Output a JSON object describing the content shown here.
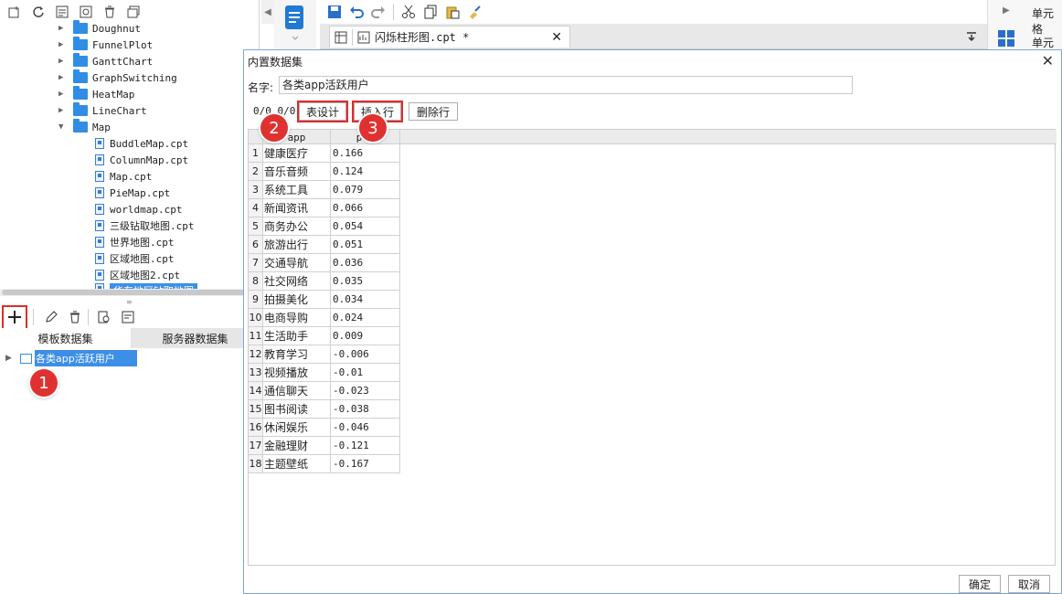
{
  "tree": {
    "items": [
      {
        "label": "Doughnut",
        "kind": "folder"
      },
      {
        "label": "FunnelPlot",
        "kind": "folder"
      },
      {
        "label": "GanttChart",
        "kind": "folder"
      },
      {
        "label": "GraphSwitching",
        "kind": "folder"
      },
      {
        "label": "HeatMap",
        "kind": "folder"
      },
      {
        "label": "LineChart",
        "kind": "folder"
      },
      {
        "label": "Map",
        "kind": "folder-open"
      },
      {
        "label": "BuddleMap.cpt",
        "kind": "file"
      },
      {
        "label": "ColumnMap.cpt",
        "kind": "file"
      },
      {
        "label": "Map.cpt",
        "kind": "file"
      },
      {
        "label": "PieMap.cpt",
        "kind": "file"
      },
      {
        "label": "worldmap.cpt",
        "kind": "file"
      },
      {
        "label": "三级钻取地图.cpt",
        "kind": "file"
      },
      {
        "label": "世界地图.cpt",
        "kind": "file"
      },
      {
        "label": "区域地图.cpt",
        "kind": "file"
      },
      {
        "label": "区域地图2.cpt",
        "kind": "file"
      },
      {
        "label": "华东地区钻取地图",
        "kind": "file"
      }
    ]
  },
  "datasets": {
    "tabs": [
      "模板数据集",
      "服务器数据集"
    ],
    "items": [
      "各类app活跃用户"
    ]
  },
  "badges": [
    "1",
    "2",
    "3"
  ],
  "editor": {
    "tab_label": "闪烁柱形图.cpt *"
  },
  "right_panel": {
    "labels": [
      "单元格"
    ]
  },
  "dialog": {
    "title": "内置数据集",
    "name_label": "名字:",
    "name_value": "各类app活跃用户",
    "counter": "0/0,0/0",
    "buttons": {
      "table_design": "表设计",
      "insert_row": "插入行",
      "delete_row": "删除行",
      "ok": "确定",
      "cancel": "取消"
    },
    "columns": [
      "app",
      "per"
    ],
    "rows": [
      {
        "n": "1",
        "app": "健康医疗",
        "per": "0.166"
      },
      {
        "n": "2",
        "app": "音乐音频",
        "per": "0.124"
      },
      {
        "n": "3",
        "app": "系统工具",
        "per": "0.079"
      },
      {
        "n": "4",
        "app": "新闻资讯",
        "per": "0.066"
      },
      {
        "n": "5",
        "app": "商务办公",
        "per": "0.054"
      },
      {
        "n": "6",
        "app": "旅游出行",
        "per": "0.051"
      },
      {
        "n": "7",
        "app": "交通导航",
        "per": "0.036"
      },
      {
        "n": "8",
        "app": "社交网络",
        "per": "0.035"
      },
      {
        "n": "9",
        "app": "拍摄美化",
        "per": "0.034"
      },
      {
        "n": "10",
        "app": "电商导购",
        "per": "0.024"
      },
      {
        "n": "11",
        "app": "生活助手",
        "per": "0.009"
      },
      {
        "n": "12",
        "app": "教育学习",
        "per": "-0.006"
      },
      {
        "n": "13",
        "app": "视频播放",
        "per": "-0.01"
      },
      {
        "n": "14",
        "app": "通信聊天",
        "per": "-0.023"
      },
      {
        "n": "15",
        "app": "图书阅读",
        "per": "-0.038"
      },
      {
        "n": "16",
        "app": "休闲娱乐",
        "per": "-0.046"
      },
      {
        "n": "17",
        "app": "金融理财",
        "per": "-0.121"
      },
      {
        "n": "18",
        "app": "主题壁纸",
        "per": "-0.167"
      }
    ]
  },
  "colors": {
    "accent": "#3c8fe6",
    "highlight_red": "#e02b2b",
    "folder_blue": "#2f8ee3"
  }
}
